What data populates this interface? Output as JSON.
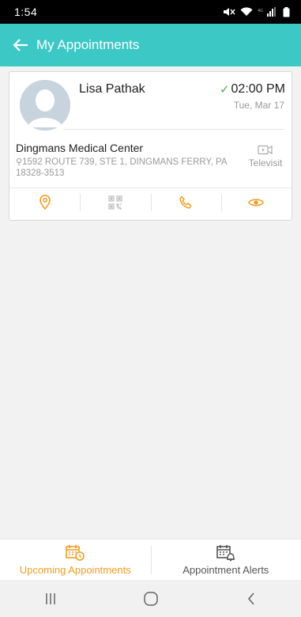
{
  "status_bar": {
    "time": "1:54"
  },
  "app_bar": {
    "title": "My Appointments"
  },
  "appointment": {
    "patient_name": "Lisa Pathak",
    "time": "02:00 PM",
    "date": "Tue, Mar 17",
    "facility_name": "Dingmans Medical Center",
    "address": "1592 ROUTE 739, STE 1, DINGMANS FERRY, PA 18328-3513",
    "televisit_label": "Televisit"
  },
  "bottom_nav": {
    "tabs": [
      {
        "label": "Upcoming Appointments",
        "icon": "calendar-clock-icon"
      },
      {
        "label": "Appointment Alerts",
        "icon": "calendar-bell-icon"
      }
    ]
  },
  "colors": {
    "accent": "#3cc8c5",
    "orange": "#f39c1f",
    "check": "#43b14a"
  }
}
